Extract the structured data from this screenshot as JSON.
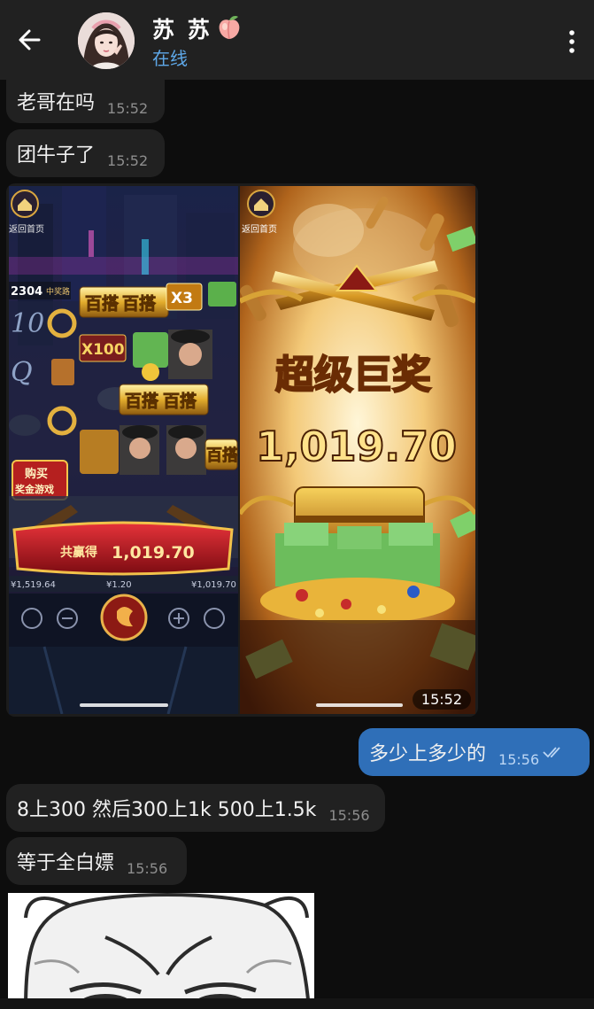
{
  "header": {
    "contact_name": "苏 苏",
    "status": "在线",
    "back_icon": "arrow-left-icon",
    "menu_icon": "more-vertical-icon",
    "emoji": "peach"
  },
  "messages": [
    {
      "text": "老哥在吗",
      "time": "15:52",
      "dir": "in"
    },
    {
      "text": "团牛子了",
      "time": "15:52",
      "dir": "in"
    },
    {
      "text": "多少上多少的",
      "time": "15:56",
      "dir": "out",
      "read": true
    },
    {
      "text": "8上300 然后300上1k 500上1.5k",
      "time": "15:56",
      "dir": "in"
    },
    {
      "text": "等于全白嫖",
      "time": "15:56",
      "dir": "in"
    }
  ],
  "media": {
    "time": "15:52",
    "left": {
      "home_label": "返回首页",
      "top_counter": "2304",
      "top_counter_label": "中奖路",
      "symbol_baida": "百搭",
      "mult_x3": "X3",
      "mult_x100": "X100",
      "buy_label_1": "购买",
      "buy_label_2": "奖金游戏",
      "win_prefix": "共赢得",
      "win_amount": "1,019.70",
      "balance": "¥1,519.64",
      "bet": "¥1.20",
      "last_win": "¥1,019.70"
    },
    "right": {
      "home_label": "返回首页",
      "banner": "超级巨奖",
      "amount": "1,019.70"
    }
  },
  "colors": {
    "background": "#0d0d0d",
    "header": "#212121",
    "incoming_bubble": "#212121",
    "outgoing_bubble": "#2f6fb8",
    "status": "#5ea8e8"
  }
}
